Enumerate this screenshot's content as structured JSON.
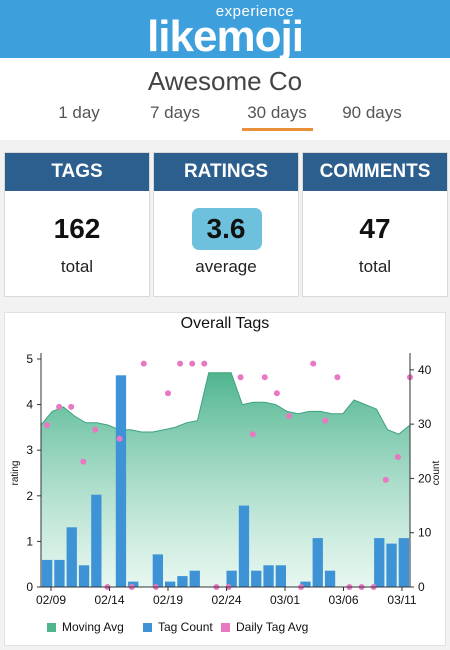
{
  "header": {
    "logo_top": "experience",
    "logo_main": "likemoji"
  },
  "company": "Awesome Co",
  "tabs": [
    {
      "label": "1 day",
      "active": false
    },
    {
      "label": "7 days",
      "active": false
    },
    {
      "label": "30 days",
      "active": true
    },
    {
      "label": "90 days",
      "active": false
    }
  ],
  "colors": {
    "header": "#3d9fdb",
    "card_head": "#2c5f8e",
    "highlight": "#6ec1dd",
    "active_tab": "#e8903a",
    "area": "#4fb58f",
    "bar": "#3d93d6",
    "dot": "#e878c1"
  },
  "cards": [
    {
      "title": "TAGS",
      "value": "162",
      "sub": "total"
    },
    {
      "title": "RATINGS",
      "value": "3.6",
      "sub": "average"
    },
    {
      "title": "COMMENTS",
      "value": "47",
      "sub": "total"
    }
  ],
  "chart_data": {
    "type": "bar",
    "title": "Overall Tags",
    "ylabel_left": "rating",
    "ylabel_right": "count",
    "ylim_left": [
      0,
      5
    ],
    "ylim_right": [
      0,
      42
    ],
    "yticks_left": [
      "0",
      "1",
      "2",
      "3",
      "4",
      "5"
    ],
    "yticks_right": [
      "0",
      "10",
      "20",
      "30",
      "40"
    ],
    "xticks": [
      "02/09",
      "02/14",
      "02/19",
      "02/24",
      "03/01",
      "03/06",
      "03/11"
    ],
    "legend_position": "bottom",
    "series": [
      {
        "name": "Moving Avg",
        "kind": "area",
        "axis": "left",
        "values": [
          3.55,
          3.85,
          3.95,
          3.75,
          3.6,
          3.6,
          3.55,
          3.45,
          3.45,
          3.4,
          3.4,
          3.45,
          3.5,
          3.6,
          3.65,
          4.7,
          4.7,
          4.7,
          4.0,
          4.05,
          4.05,
          4.0,
          3.85,
          3.8,
          3.85,
          3.85,
          3.8,
          3.8,
          4.1,
          4.0,
          3.9,
          3.45,
          3.35,
          3.55
        ]
      },
      {
        "name": "Tag Count",
        "kind": "bar",
        "axis": "right",
        "values": [
          5,
          5,
          11,
          4,
          17,
          0,
          39,
          1,
          0,
          6,
          1,
          2,
          3,
          0,
          0,
          3,
          15,
          3,
          4,
          4,
          0,
          1,
          9,
          3,
          0,
          0,
          0,
          9,
          8,
          9
        ]
      },
      {
        "name": "Daily Tag Avg",
        "kind": "dots",
        "axis": "left",
        "values": [
          3.55,
          3.95,
          3.95,
          2.75,
          3.45,
          0,
          3.25,
          0,
          4.9,
          0,
          4.25,
          4.9,
          4.9,
          4.9,
          0,
          0,
          4.6,
          3.35,
          4.6,
          4.25,
          3.75,
          0,
          4.9,
          3.65,
          4.6,
          0,
          0,
          0,
          2.35,
          2.85,
          4.6
        ]
      }
    ]
  }
}
